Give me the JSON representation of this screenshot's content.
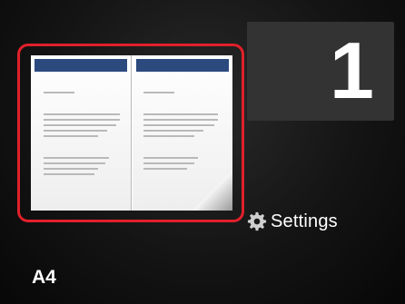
{
  "copies": {
    "value": "1"
  },
  "settings": {
    "label": "Settings",
    "icon": "gear-icon"
  },
  "paper": {
    "size": "A4"
  },
  "preview": {
    "layout": "two-page-spread",
    "selected": true
  },
  "colors": {
    "selection": "#e0202a",
    "header": "#2c4a7e"
  }
}
